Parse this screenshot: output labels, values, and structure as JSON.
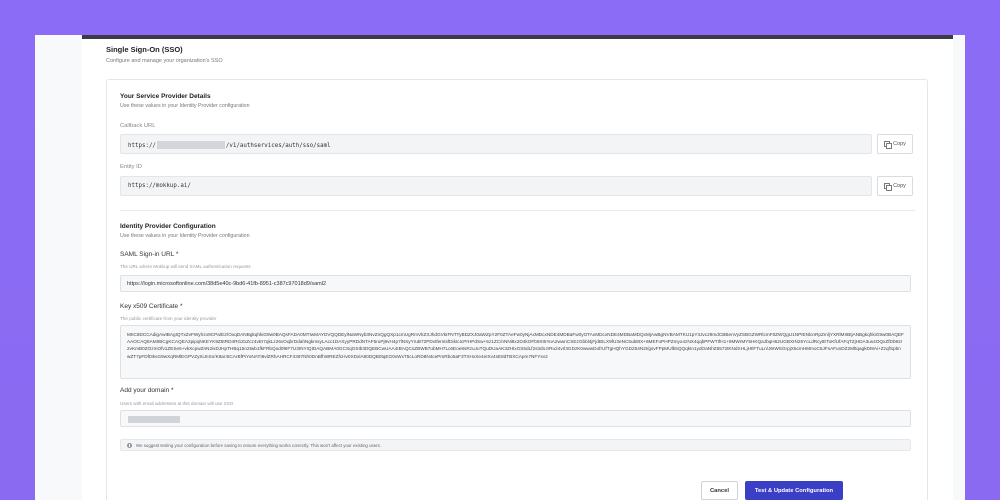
{
  "header": {
    "title": "Single Sign-On (SSO)",
    "subtitle": "Configure and manage your organization's SSO"
  },
  "service_provider": {
    "title": "Your Service Provider Details",
    "subtitle": "Use these values in your Identity Provider configuration",
    "callback_label": "Callback URL",
    "callback_prefix": "https://",
    "callback_suffix": "/v1/authservices/auth/sso/saml",
    "entity_label": "Entity ID",
    "entity_value": "https://mokkup.ai/",
    "copy_label": "Copy"
  },
  "identity_provider": {
    "title": "Identity Provider Configuration",
    "subtitle": "Use these values in your Identity Provider configuration",
    "signin_label": "SAML Sign-in URL *",
    "signin_help": "The URL where Mokkup will send SAML authentication requests",
    "signin_value": "https://login.microsoftonline.com/38d5e40c-9bd6-41fb-8951-c387c97018d9/saml2",
    "cert_label": "Key x509 Certificate *",
    "cert_help": "The public certificate from your identity provider",
    "cert_value": "MIIC8DCCAdigAwIBAgIQTxZvFWyhzo9CPa/E2/OxqDANBgkqhkiG9w0BAQsFADA0MTIwMAYDVQQDEylNaWNyb3NvZnQgQXp1cmUgRmVkZXJhdGVkIFNTTyBDZXJ0aWZpY2F0ZTAeFw0yNjAxMDcxNDE4MDBaFw0yOTAxMDcxNDE4MDBaMDQxMjAwBgNVBAMTKU1pY3Jvc29mdCBBenVyZSBGZWRlcmF0ZWQgU1NPIENlcnRpZmljYXRlMIIBIjANBgkqhkiG9w0BAQEFAAOCAQ8AMIIBCgKCAQEA2pipqNKEYK9Z5tRD4RGZxZcz4vEI7qkLz26vOqbrDdahNgkmsyLAcc1DAXyyPRDdNTAF5ruPj9vH4p7lNSyYruB72PDvtfemtsfDikIcIcPrHPdSw+5z1ZC/nNNi8x2D4kOFb9Xt5YoA2wwnCSEzGbbl4jFjdBILX9fU3eNC5ub8tX+6MEFoPHPZmyo4zNX4qqbPFWTIfH1+9MWrMY5HKQaJbqH62UGBXIN25YcLdRcyIEToKfUfAFqTZjHDA3us4OQxZfDb92r2vKmB0ZOzmOfv1ZESe6+vkXcpwZnN2isDJHpTHBq15n2twb1fkFRbQod09IF7U3INYIQIDAQABMA0GCSqGSIb3DQEBCwUAA4IBAQCsZBWB7ubMH7Lc6Eoe8sRzuJuTQuDUaAK3ZHlxGS5dLf2s3dnJrRu24vrl3GDzK0wwwDofrUfTgHQhYGD254N2I/gsvFPpMUlb5QQqkIn1ydOaNhZ6572tKNdXHLjHIlFTuLn/J6IWSGrpjX6cmHMmoC6JFsAFunDZ2MltqagkDt9Ai+ZzqfSpbnwZT7pFDft3ksG9wXqRMlEGPVZySiJnSn/K8ar4tCArBfPiYoNATI8vlZRhAHRCF4397Nh0DnBfhWREZfcHv0XDxlA80DQB0tqEG0vWxT5cLoRD8N4cePmRbo5aF3TXHxXe4eIXv4sE8dTBXCApm7NFYsv2"
  },
  "domain": {
    "label": "Add your domain *",
    "help": "Users with email addresses at this domain will use SSO"
  },
  "info_text": "We suggest testing your configuration before saving to ensure everything works correctly. This won't affect your existing users.",
  "footer": {
    "cancel_label": "Cancel",
    "submit_label": "Test & Update Configuration"
  },
  "colors": {
    "background_gradient": "#8b6cf6",
    "primary_button": "#3b3fc6",
    "top_bar": "#3b3b48"
  }
}
